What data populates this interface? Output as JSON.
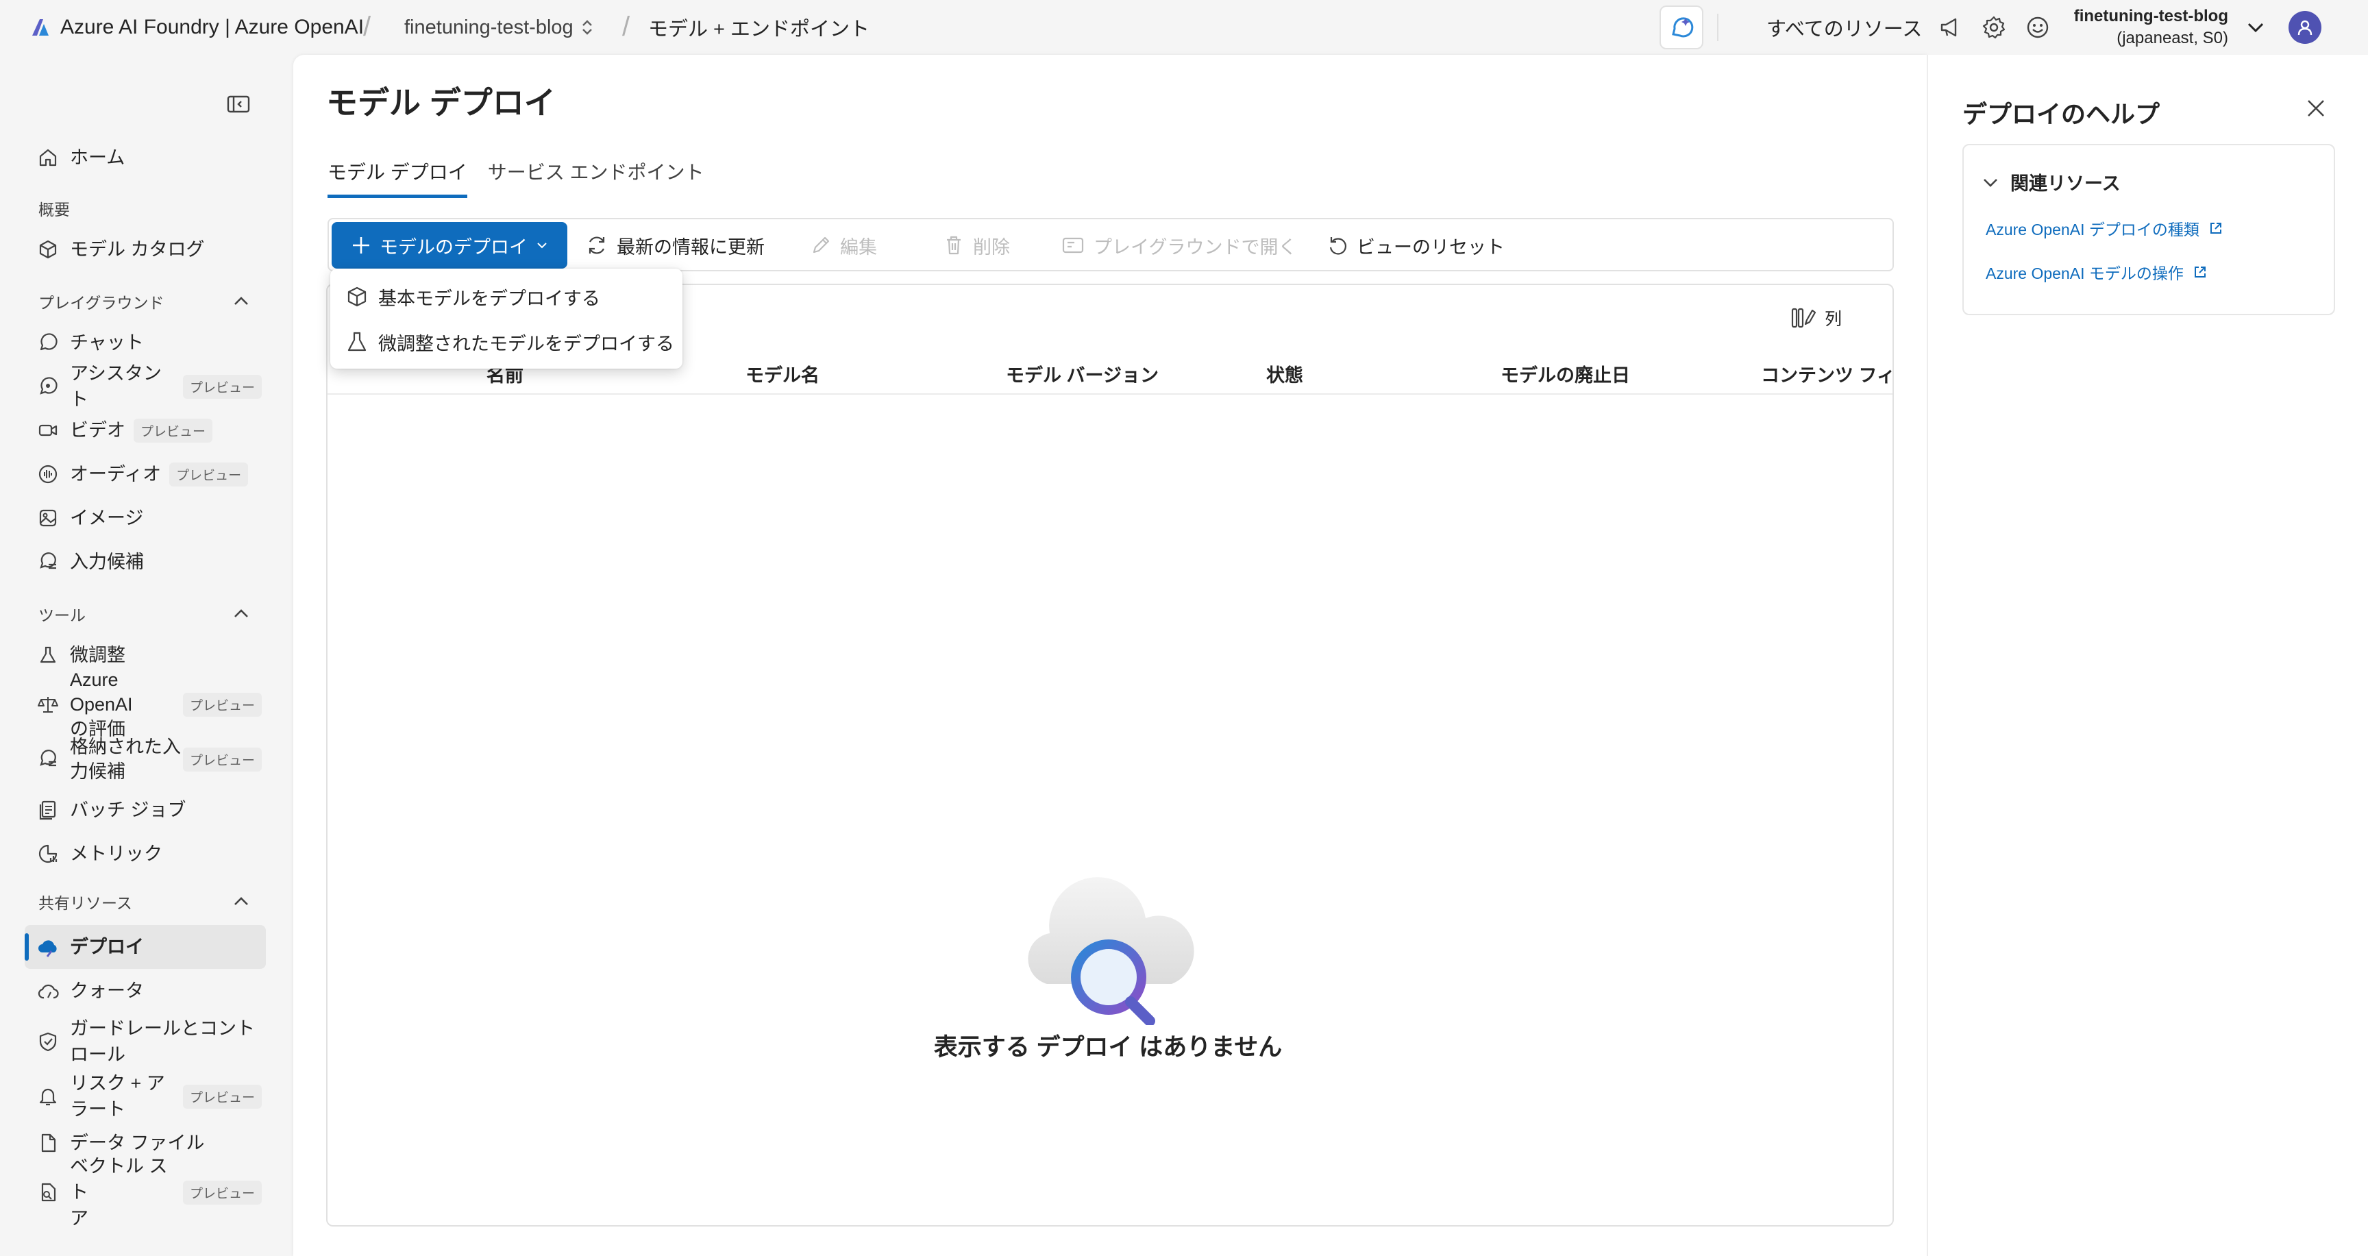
{
  "topbar": {
    "brand": "Azure AI Foundry | Azure OpenAI",
    "project": "finetuning-test-blog",
    "page": "モデル + エンドポイント",
    "all_resources": "すべてのリソース",
    "account_name": "finetuning-test-blog",
    "account_region": "(japaneast, S0)",
    "icons": [
      "copilot-icon",
      "announcement-icon",
      "settings-icon",
      "feedback-icon",
      "chevron-down-icon",
      "avatar"
    ]
  },
  "sidebar": {
    "home": "ホーム",
    "overview_section": "概要",
    "model_catalog": "モデル カタログ",
    "playground_section": "プレイグラウンド",
    "chat": "チャット",
    "assistant": "アシスタント",
    "video": "ビデオ",
    "audio": "オーディオ",
    "image": "イメージ",
    "completions": "入力候補",
    "tools_section": "ツール",
    "finetune": "微調整",
    "evaluation_1": "Azure OpenAI",
    "evaluation_2": "の評価",
    "stored_1": "格納された入",
    "stored_2": "力候補",
    "batch": "バッチ ジョブ",
    "metrics": "メトリック",
    "shared_section": "共有リソース",
    "deploy": "デプロイ",
    "quota": "クォータ",
    "guardrails_1": "ガードレールとコント",
    "guardrails_2": "ロール",
    "risk_1": "リスク + ア",
    "risk_2": "ラート",
    "data_files": "データ ファイル",
    "vector_1": "ベクトル スト",
    "vector_2": "ア",
    "preview_badge": "プレビュー"
  },
  "main": {
    "title": "モデル デプロイ",
    "tabs": [
      "モデル デプロイ",
      "サービス エンドポイント"
    ],
    "toolbar": {
      "deploy": "モデルのデプロイ",
      "refresh": "最新の情報に更新",
      "edit": "編集",
      "delete": "削除",
      "playground": "プレイグラウンドで開く",
      "reset": "ビューのリセット"
    },
    "dropdown": [
      "基本モデルをデプロイする",
      "微調整されたモデルをデプロイする"
    ],
    "columns_button": "列",
    "columns": [
      "名前",
      "モデル名",
      "モデル バージョン",
      "状態",
      "モデルの廃止日",
      "コンテンツ フィルター"
    ],
    "empty": "表示する デプロイ はありません"
  },
  "help": {
    "title": "デプロイのヘルプ",
    "section": "関連リソース",
    "links": [
      "Azure OpenAI デプロイの種類",
      "Azure OpenAI モデルの操作"
    ]
  },
  "colors": {
    "accent": "#0f6cbd",
    "avatar": "#4f52b2"
  }
}
